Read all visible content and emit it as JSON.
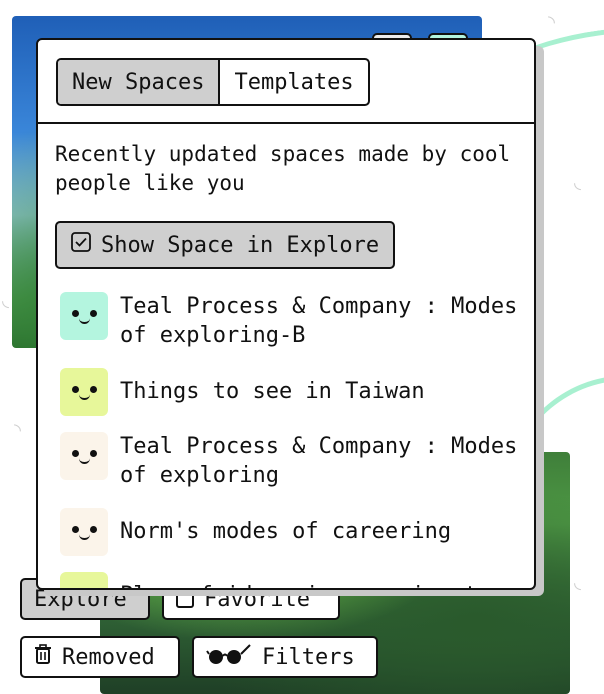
{
  "popover": {
    "tabs": [
      {
        "label": "New Spaces",
        "active": true
      },
      {
        "label": "Templates",
        "active": false
      }
    ],
    "description": "Recently updated spaces made by cool people like you",
    "show_in_explore_label": "Show Space in Explore",
    "spaces": [
      {
        "name": "Teal Process & Company : Modes of exploring-B",
        "avatar_color": "#b4f5df"
      },
      {
        "name": "Things to see in Taiwan",
        "avatar_color": "#e7f79a"
      },
      {
        "name": "Teal Process & Company : Modes of exploring",
        "avatar_color": "#fbf4ea"
      },
      {
        "name": "Norm's modes of careering",
        "avatar_color": "#fbf4ea"
      },
      {
        "name": "Play of ideas in experiment",
        "avatar_color": "#e7f79a"
      }
    ]
  },
  "toolbar": {
    "explore_label": "Explore",
    "favorite_label": "Favorite",
    "removed_label": "Removed",
    "filters_label": "Filters"
  },
  "icons": {
    "checkbox": "checkbox-checked-icon",
    "trash": "trash-icon",
    "filters": "glasses-icon",
    "favorite": "checkbox-empty-icon"
  },
  "colors": {
    "active_bg": "#cfcfcf",
    "border": "#111111",
    "canvas_curve": "#a8f0d0"
  }
}
